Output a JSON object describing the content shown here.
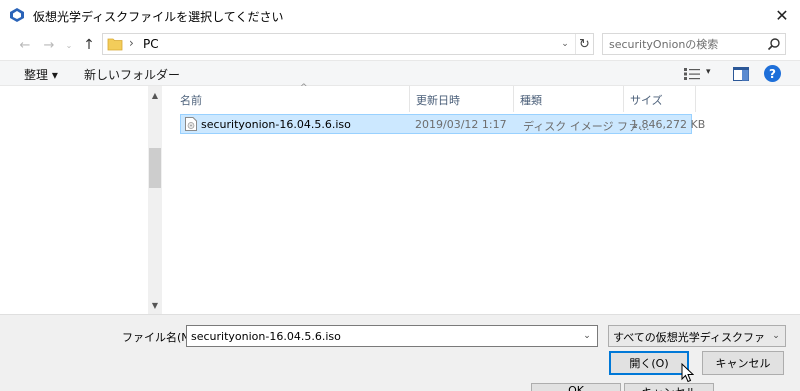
{
  "window": {
    "title": "仮想光学ディスクファイルを選択してください",
    "close_glyph": "✕"
  },
  "nav": {
    "back_glyph": "←",
    "forward_glyph": "→",
    "recent_glyph": "⌄",
    "up_glyph": "↑",
    "path_separator": "›",
    "path": "PC",
    "dropdown_glyph": "⌄",
    "refresh_glyph": "↻"
  },
  "search": {
    "placeholder": "securityOnionの検索"
  },
  "toolbar": {
    "organize_label": "整理 ▾",
    "new_folder_label": "新しいフォルダー",
    "view_dropdown_glyph": "▾",
    "help_label": "?"
  },
  "columns": {
    "name": "名前",
    "date": "更新日時",
    "type": "種類",
    "size": "サイズ",
    "sort_glyph": "^"
  },
  "files": [
    {
      "name": "securityonion-16.04.5.6.iso",
      "date": "2019/03/12 1:17",
      "type": "ディスク イメージ ファ...",
      "size": "1,846,272 KB",
      "selected": true
    }
  ],
  "footer": {
    "filename_label": "ファイル名(N):",
    "filename_value": "securityonion-16.04.5.6.iso",
    "filter_value": "すべての仮想光学ディスクファイル (*",
    "open_label": "開く(O)",
    "cancel_label": "キャンセル",
    "ghost_ok": "OK",
    "ghost_cancel": "キャンセル"
  },
  "scroll": {
    "up_glyph": "▲",
    "down_glyph": "▼"
  },
  "colors": {
    "selection_bg": "#cce8ff",
    "selection_border": "#99d1ff",
    "accent": "#0078d7",
    "help": "#1e6fd9"
  },
  "icons": [
    "vbox-app-icon",
    "folder-icon",
    "search-icon",
    "view-options-icon",
    "preview-pane-icon",
    "help-icon",
    "iso-file-icon",
    "mouse-cursor-icon"
  ]
}
